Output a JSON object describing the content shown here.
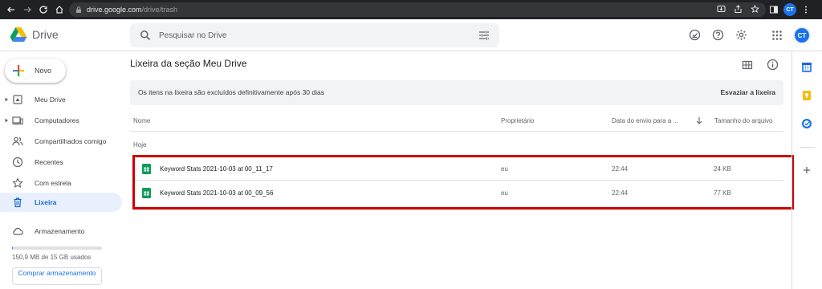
{
  "browser": {
    "url_host": "drive.google.com",
    "url_path": "/drive/trash",
    "profile_initials": "CT"
  },
  "app": {
    "name": "Drive",
    "search_placeholder": "Pesquisar no Drive",
    "account_initials": "CT"
  },
  "sidebar": {
    "new_label": "Novo",
    "items": [
      {
        "label": "Meu Drive",
        "icon": "my-drive-icon",
        "expandable": true
      },
      {
        "label": "Computadores",
        "icon": "computers-icon",
        "expandable": true
      },
      {
        "label": "Compartilhados comigo",
        "icon": "shared-icon",
        "expandable": false
      },
      {
        "label": "Recentes",
        "icon": "clock-icon",
        "expandable": false
      },
      {
        "label": "Com estrela",
        "icon": "star-icon",
        "expandable": false
      },
      {
        "label": "Lixeira",
        "icon": "trash-icon",
        "expandable": false,
        "active": true
      },
      {
        "label": "Armazenamento",
        "icon": "cloud-icon",
        "expandable": false
      }
    ],
    "storage_text": "150,9 MB de 15 GB usados",
    "storage_fraction": 0.01,
    "buy_label": "Comprar armazenamento"
  },
  "main": {
    "title": "Lixeira da seção Meu Drive",
    "banner_text": "Os itens na lixeira são excluídos definitivamente após 30 dias",
    "empty_trash_label": "Esvaziar a lixeira",
    "columns": {
      "name": "Nome",
      "owner": "Proprietário",
      "date": "Data do envio para a ...",
      "size": "Tamanho do arquivo"
    },
    "group_label": "Hoje",
    "files": [
      {
        "name": "Keyword Stats 2021-10-03 at 00_11_17",
        "owner": "eu",
        "date": "22:44",
        "size": "24 KB"
      },
      {
        "name": "Keyword Stats 2021-10-03 at 00_09_56",
        "owner": "eu",
        "date": "22:44",
        "size": "77 KB"
      }
    ]
  },
  "colors": {
    "accent": "#1a73e8",
    "active_bg": "#e8f0fe",
    "highlight": "#cc0000",
    "sheets_green": "#0f9d58"
  }
}
